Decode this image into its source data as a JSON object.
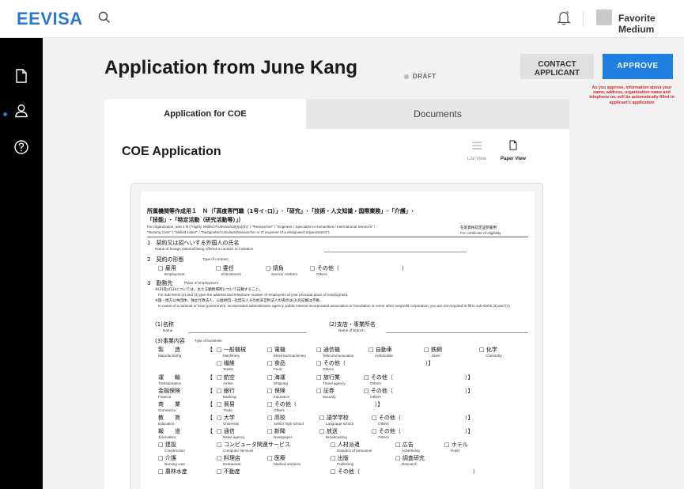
{
  "header": {
    "logo": "EEVISA",
    "user_name": "Favorite Medium"
  },
  "sidebar": {
    "items": [
      {
        "icon": "document-icon",
        "active": true
      },
      {
        "icon": "user-icon",
        "active": false
      },
      {
        "icon": "help-icon",
        "active": false
      }
    ]
  },
  "page": {
    "title": "Application from June Kang",
    "status": "DRAFT",
    "contact_button_line1": "CONTACT",
    "contact_button_line2": "APPLICANT",
    "approve_button": "APPROVE",
    "approve_note": "As you approve, information about your name, address, organization name and telephone no. will be automatically filled in applicant's application"
  },
  "tabs": [
    {
      "label": "Application for COE",
      "active": true
    },
    {
      "label": "Documents",
      "active": false
    }
  ],
  "panel": {
    "title": "COE Application",
    "view_list": "List View",
    "view_paper": "Paper View"
  },
  "form": {
    "heading1": "所属機関等作成用１　Ｎ（「高度専門職（1号イ･ロ）」･「研究」･「技術・人文知識・国際業務」･「介護」･",
    "heading2": "「技能」･「特定活動（研究活動等）」）",
    "sub_en1": "For organization, part 1  N (\"Highly Skilled Professional(i)(a)/(b)\" / \"Researcher\" / \"Engineer / Specialist in Humanities / International Services\" /",
    "sub_en2": "\"Nursing Care\" / \"Skilled Labor\" / \"Designated Activities(Researcher or IT engineer of a designated organization)\")",
    "right_jp": "在留資格認定証明書用",
    "right_en": "For certificate of eligibility",
    "s1_jp": "1　契約又は招へいする外国人の氏名",
    "s1_en": "Name of foreign national being offered a contract or invitation",
    "s2_jp": "2　契約の形態",
    "s2_en": "Type of contract",
    "s2_opts": [
      {
        "jp": "□ 雇用",
        "en": "Employment"
      },
      {
        "jp": "□ 委任",
        "en": "Entrustment"
      },
      {
        "jp": "□ 請負",
        "en": "Service contract"
      },
      {
        "jp": "□ その他（",
        "en": "Others"
      }
    ],
    "s2_close": "）",
    "s3_jp": "3　勤務先",
    "s3_en": "Place of employment",
    "s3_note_jp1": "※(2)及び(3)については，主たる勤務場所について記載すること。",
    "s3_note_en1": "For sub-items (2) and (3) give the address and telephone number of employees of your principal place of employment.",
    "s3_note_jp2": "※国・地方公共団体，独立行政法人，公益財団・社団法人その他非営利法人の場合は(3)の記載は不要。",
    "s3_note_en2": "In cases of a national or local government, incorporated administrative agency, public interest incorporated association or foundation or some other nonprofit corporation, you are not required to fill in sub-items (3) and (4).",
    "name_jp": "(1)名称",
    "name_en": "Name",
    "branch_jp": "(2)支店・事業所名",
    "branch_en": "Name of branch",
    "biz_jp": "(3)事業内容",
    "biz_en": "Type of business",
    "rows": [
      {
        "cat_jp": "製　　造",
        "cat_en": "Manufacturing",
        "items": [
          {
            "jp": "□ 一般機械",
            "en": "Machinery"
          },
          {
            "jp": "□ 電機",
            "en": "Electrical machinery"
          },
          {
            "jp": "□ 通信機",
            "en": "Telecommunication"
          },
          {
            "jp": "□ 自動車",
            "en": "Automobile"
          },
          {
            "jp": "□ 鉄鋼",
            "en": "Steel"
          },
          {
            "jp": "□ 化学",
            "en": "Chemistry"
          }
        ]
      },
      {
        "cat_jp": "",
        "cat_en": "",
        "items": [
          {
            "jp": "□ 繊維",
            "en": "Textile"
          },
          {
            "jp": "□ 食品",
            "en": "Food"
          },
          {
            "jp": "□ その他（",
            "en": "Others"
          }
        ]
      },
      {
        "cat_jp": "運　　輸",
        "cat_en": "Transportation",
        "items": [
          {
            "jp": "□ 航空",
            "en": "Airline"
          },
          {
            "jp": "□ 海運",
            "en": "Shipping"
          },
          {
            "jp": "□ 旅行業",
            "en": "Travel agency"
          },
          {
            "jp": "□ その他（",
            "en": "Others"
          }
        ]
      },
      {
        "cat_jp": "金融保険",
        "cat_en": "Finance",
        "items": [
          {
            "jp": "□ 銀行",
            "en": "Banking"
          },
          {
            "jp": "□ 保険",
            "en": "Insurance"
          },
          {
            "jp": "□ 証券",
            "en": "Security"
          },
          {
            "jp": "□ その他（",
            "en": "Others"
          }
        ]
      },
      {
        "cat_jp": "商　　業",
        "cat_en": "Commerce",
        "items": [
          {
            "jp": "□ 貿易",
            "en": "Trade"
          },
          {
            "jp": "□ その他（",
            "en": "Others"
          }
        ]
      },
      {
        "cat_jp": "教　　育",
        "cat_en": "Education",
        "items": [
          {
            "jp": "□ 大学",
            "en": "University"
          },
          {
            "jp": "□ 高校",
            "en": "Senior high school"
          },
          {
            "jp": "□ 語学学校",
            "en": "Language school"
          },
          {
            "jp": "□ その他（",
            "en": "Others"
          }
        ]
      },
      {
        "cat_jp": "報　　道",
        "cat_en": "Journalism",
        "items": [
          {
            "jp": "□ 通信",
            "en": "News agency"
          },
          {
            "jp": "□ 新聞",
            "en": "Newspaper"
          },
          {
            "jp": "□ 放送",
            "en": "Broadcasting"
          },
          {
            "jp": "□ その他（",
            "en": "Others"
          }
        ]
      },
      {
        "cat_jp": "",
        "cat_en": "",
        "items": [
          {
            "jp": "□ 建設",
            "en": "Construction"
          },
          {
            "jp": "□ コンピュータ関連サービス",
            "en": "Computer services"
          },
          {
            "jp": "□ 人材派遣",
            "en": "Dispatch of personnel"
          },
          {
            "jp": "□ 広告",
            "en": "Advertising"
          },
          {
            "jp": "□ ホテル",
            "en": "Hotel"
          }
        ]
      },
      {
        "cat_jp": "",
        "cat_en": "",
        "items": [
          {
            "jp": "□ 介護",
            "en": "Nursing care"
          },
          {
            "jp": "□ 料理店",
            "en": "Restaurant"
          },
          {
            "jp": "□ 医療",
            "en": "Medical services"
          },
          {
            "jp": "□ 出版",
            "en": "Publishing"
          },
          {
            "jp": "□ 調査研究",
            "en": "Research"
          }
        ]
      },
      {
        "cat_jp": "",
        "cat_en": "",
        "items": [
          {
            "jp": "□ 農林水産",
            "en": ""
          },
          {
            "jp": "□ 不動産",
            "en": ""
          },
          {
            "jp": "□ その他（",
            "en": ""
          }
        ]
      }
    ]
  }
}
